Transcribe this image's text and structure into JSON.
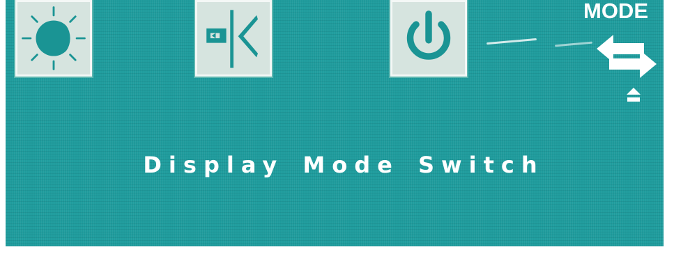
{
  "osd": {
    "icons": [
      {
        "name": "brightness-contrast-icon"
      },
      {
        "name": "input-source-icon"
      },
      {
        "name": "power-icon"
      }
    ],
    "mode_label": "MODE",
    "mode_icon": "switch-arrows-icon",
    "mode_hint_icon": "up-arrow-icon",
    "status_text": "Display Mode Switch"
  },
  "colors": {
    "background": "#1f9c9d",
    "tile": "#d6e4df",
    "glyph": "#1a9494",
    "text": "#ffffff"
  }
}
